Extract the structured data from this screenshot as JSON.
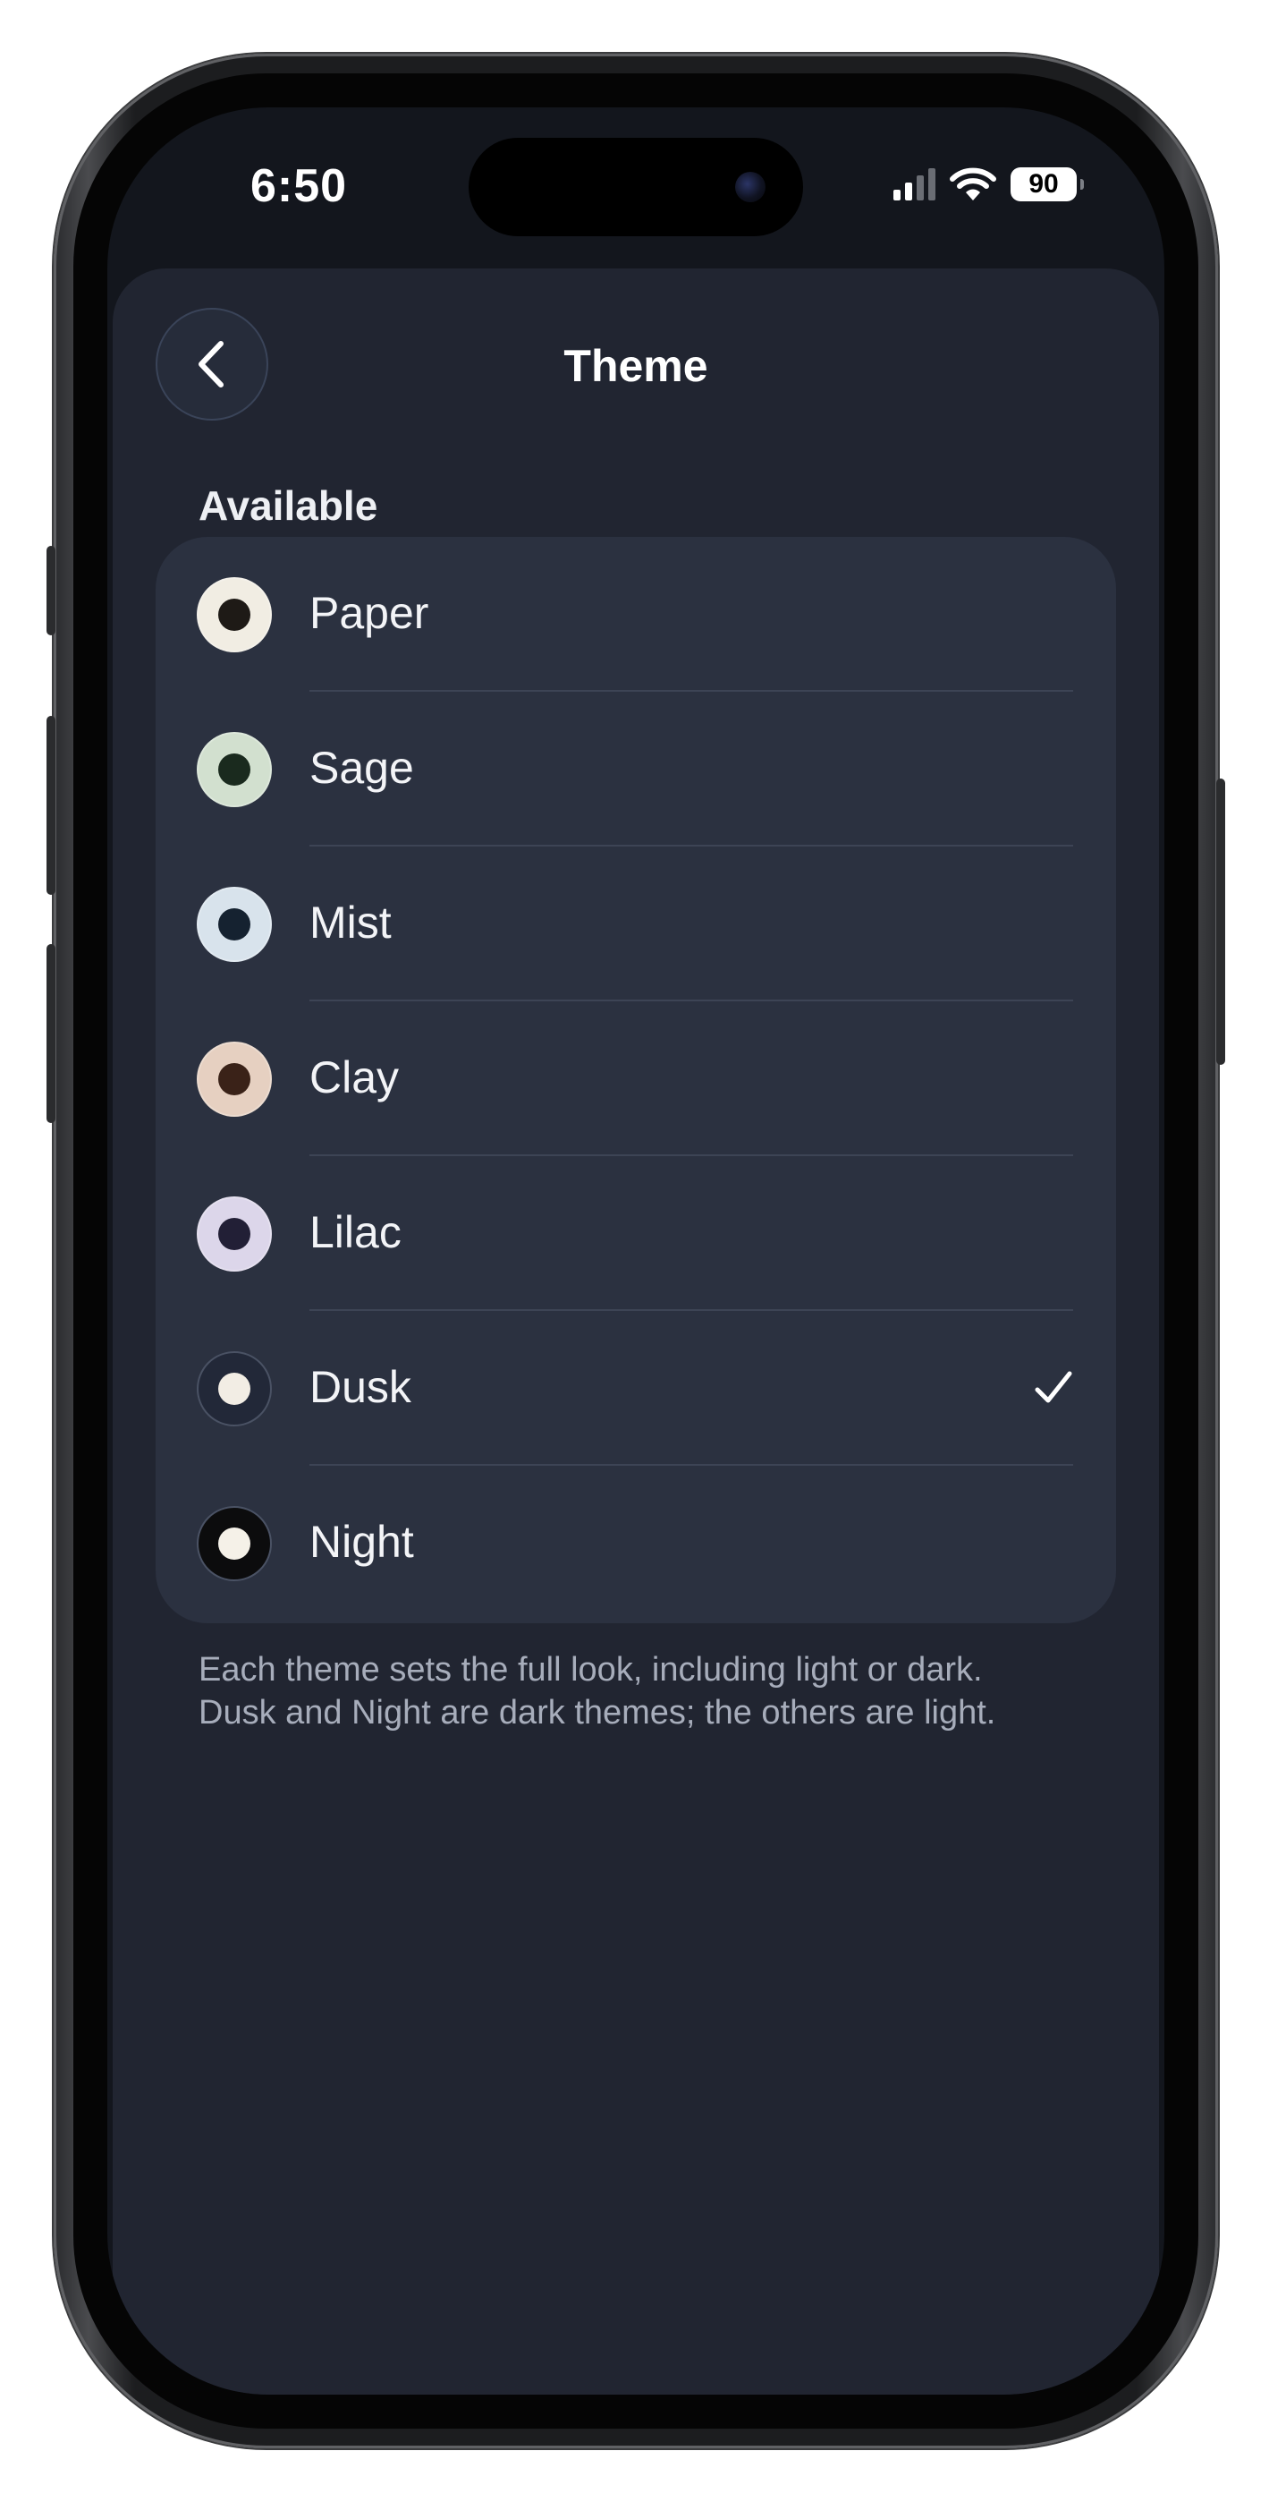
{
  "status_bar": {
    "time": "6:50",
    "battery_level": "90",
    "icons": [
      "cellular-signal-icon",
      "wifi-icon",
      "battery-icon"
    ]
  },
  "header": {
    "title": "Theme",
    "back_icon": "chevron-left-icon"
  },
  "section": {
    "title": "Available"
  },
  "themes": [
    {
      "label": "Paper",
      "ring": "#f1ede3",
      "dot": "#1e1a16",
      "selected": false
    },
    {
      "label": "Sage",
      "ring": "#d2e0cf",
      "dot": "#1a2a1e",
      "selected": false
    },
    {
      "label": "Mist",
      "ring": "#d8e3ec",
      "dot": "#152230",
      "selected": false
    },
    {
      "label": "Clay",
      "ring": "#e6d0c1",
      "dot": "#3a2218",
      "selected": false
    },
    {
      "label": "Lilac",
      "ring": "#dcd6ea",
      "dot": "#221f36",
      "selected": false
    },
    {
      "label": "Dusk",
      "ring": "#222838",
      "dot": "#f2ede4",
      "selected": true
    },
    {
      "label": "Night",
      "ring": "#0c0c0d",
      "dot": "#f5f1e8",
      "selected": false
    }
  ],
  "footer": {
    "note_line1": "Each theme sets the full look, including light or dark.",
    "note_line2": "Dusk and Night are dark themes; the others are light."
  },
  "colors": {
    "screen_bg": "#13161d",
    "sheet_bg": "#212531",
    "card_bg": "#2b3140",
    "text_primary": "#f3f4f7",
    "text_secondary": "#a7adbb"
  }
}
